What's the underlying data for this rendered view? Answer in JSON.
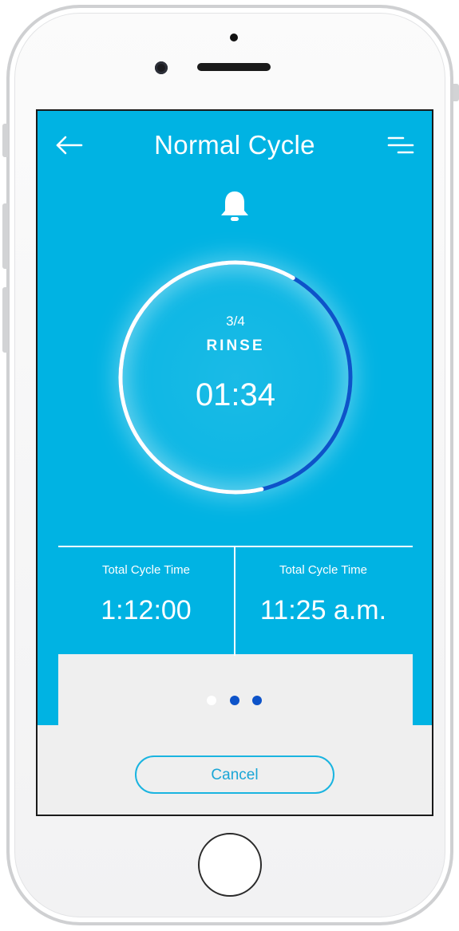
{
  "app": {
    "title": "Normal Cycle",
    "back_icon": "arrow-left-icon",
    "menu_icon": "menu-lines-icon",
    "bell_icon": "bell-icon"
  },
  "cycle": {
    "step": "3/4",
    "phase": "RINSE",
    "remaining": "01:34",
    "progress_fraction": 0.62
  },
  "stats": [
    {
      "label": "Total Cycle Time",
      "value": "1:12:00"
    },
    {
      "label": "Total Cycle Time",
      "value": "11:25 a.m."
    }
  ],
  "pager": {
    "count": 3,
    "active": 0
  },
  "footer": {
    "cancel_label": "Cancel"
  },
  "colors": {
    "screen_bg": "#00b3e3",
    "progress_blue": "#0d53c9",
    "white": "#ffffff",
    "footer_bg": "#efefef",
    "button_accent": "#1ab4e0"
  }
}
